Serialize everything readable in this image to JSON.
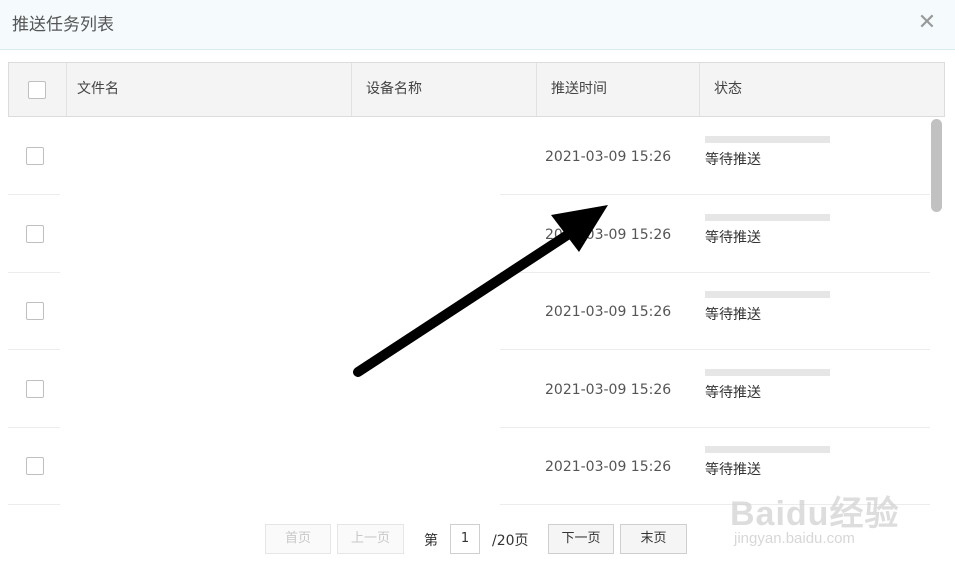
{
  "dialog": {
    "title": "推送任务列表",
    "close_glyph": "✕"
  },
  "table": {
    "columns": [
      "文件名",
      "设备名称",
      "推送时间",
      "状态"
    ],
    "rows": [
      {
        "file_name": "",
        "device_name": "",
        "push_time": "2021-03-09 15:26",
        "status": "等待推送"
      },
      {
        "file_name": "",
        "device_name": "",
        "push_time": "2021-03-09 15:26",
        "status": "等待推送"
      },
      {
        "file_name": "",
        "device_name": "",
        "push_time": "2021-03-09 15:26",
        "status": "等待推送"
      },
      {
        "file_name": "",
        "device_name": "",
        "push_time": "2021-03-09 15:26",
        "status": "等待推送"
      },
      {
        "file_name": "",
        "device_name": "",
        "push_time": "2021-03-09 15:26",
        "status": "等待推送"
      }
    ]
  },
  "pager": {
    "first_label": "首页",
    "prev_label": "上一页",
    "page_prefix": "第",
    "current_page": "1",
    "total_suffix": "/20页",
    "next_label": "下一页",
    "last_label": "末页"
  },
  "watermark": {
    "logo": "Baidu经验",
    "url": "jingyan.baidu.com"
  },
  "colors": {
    "header_bg": "#f5fbfd",
    "table_header_bg": "#f4f4f4",
    "arrow": "#000000"
  }
}
